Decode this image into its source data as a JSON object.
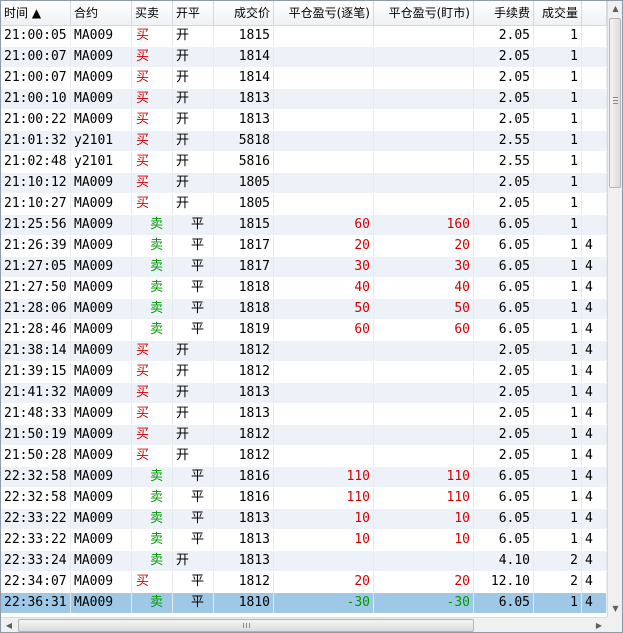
{
  "columns": {
    "time": "时间 ▲",
    "symbol": "合约",
    "bs": "买卖",
    "oc": "开平",
    "price": "成交价",
    "pnl_trade": "平仓盈亏(逐笔)",
    "pnl_mtm": "平仓盈亏(盯市)",
    "fee": "手续费",
    "qty": "成交量"
  },
  "rows": [
    {
      "time": "21:00:05",
      "symbol": "MA009",
      "bs": "买",
      "oc": "开",
      "price": "1815",
      "pnl_trade": "",
      "pnl_mtm": "",
      "fee": "2.05",
      "qty": "1",
      "ext": ""
    },
    {
      "time": "21:00:07",
      "symbol": "MA009",
      "bs": "买",
      "oc": "开",
      "price": "1814",
      "pnl_trade": "",
      "pnl_mtm": "",
      "fee": "2.05",
      "qty": "1",
      "ext": ""
    },
    {
      "time": "21:00:07",
      "symbol": "MA009",
      "bs": "买",
      "oc": "开",
      "price": "1814",
      "pnl_trade": "",
      "pnl_mtm": "",
      "fee": "2.05",
      "qty": "1",
      "ext": ""
    },
    {
      "time": "21:00:10",
      "symbol": "MA009",
      "bs": "买",
      "oc": "开",
      "price": "1813",
      "pnl_trade": "",
      "pnl_mtm": "",
      "fee": "2.05",
      "qty": "1",
      "ext": ""
    },
    {
      "time": "21:00:22",
      "symbol": "MA009",
      "bs": "买",
      "oc": "开",
      "price": "1813",
      "pnl_trade": "",
      "pnl_mtm": "",
      "fee": "2.05",
      "qty": "1",
      "ext": ""
    },
    {
      "time": "21:01:32",
      "symbol": "y2101",
      "bs": "买",
      "oc": "开",
      "price": "5818",
      "pnl_trade": "",
      "pnl_mtm": "",
      "fee": "2.55",
      "qty": "1",
      "ext": ""
    },
    {
      "time": "21:02:48",
      "symbol": "y2101",
      "bs": "买",
      "oc": "开",
      "price": "5816",
      "pnl_trade": "",
      "pnl_mtm": "",
      "fee": "2.55",
      "qty": "1",
      "ext": ""
    },
    {
      "time": "21:10:12",
      "symbol": "MA009",
      "bs": "买",
      "oc": "开",
      "price": "1805",
      "pnl_trade": "",
      "pnl_mtm": "",
      "fee": "2.05",
      "qty": "1",
      "ext": ""
    },
    {
      "time": "21:10:27",
      "symbol": "MA009",
      "bs": "买",
      "oc": "开",
      "price": "1805",
      "pnl_trade": "",
      "pnl_mtm": "",
      "fee": "2.05",
      "qty": "1",
      "ext": ""
    },
    {
      "time": "21:25:56",
      "symbol": "MA009",
      "bs": "卖",
      "oc": "平",
      "price": "1815",
      "pnl_trade": "60",
      "pnl_mtm": "160",
      "fee": "6.05",
      "qty": "1",
      "ext": ""
    },
    {
      "time": "21:26:39",
      "symbol": "MA009",
      "bs": "卖",
      "oc": "平",
      "price": "1817",
      "pnl_trade": "20",
      "pnl_mtm": "20",
      "fee": "6.05",
      "qty": "1",
      "ext": "4"
    },
    {
      "time": "21:27:05",
      "symbol": "MA009",
      "bs": "卖",
      "oc": "平",
      "price": "1817",
      "pnl_trade": "30",
      "pnl_mtm": "30",
      "fee": "6.05",
      "qty": "1",
      "ext": "4"
    },
    {
      "time": "21:27:50",
      "symbol": "MA009",
      "bs": "卖",
      "oc": "平",
      "price": "1818",
      "pnl_trade": "40",
      "pnl_mtm": "40",
      "fee": "6.05",
      "qty": "1",
      "ext": "4"
    },
    {
      "time": "21:28:06",
      "symbol": "MA009",
      "bs": "卖",
      "oc": "平",
      "price": "1818",
      "pnl_trade": "50",
      "pnl_mtm": "50",
      "fee": "6.05",
      "qty": "1",
      "ext": "4"
    },
    {
      "time": "21:28:46",
      "symbol": "MA009",
      "bs": "卖",
      "oc": "平",
      "price": "1819",
      "pnl_trade": "60",
      "pnl_mtm": "60",
      "fee": "6.05",
      "qty": "1",
      "ext": "4"
    },
    {
      "time": "21:38:14",
      "symbol": "MA009",
      "bs": "买",
      "oc": "开",
      "price": "1812",
      "pnl_trade": "",
      "pnl_mtm": "",
      "fee": "2.05",
      "qty": "1",
      "ext": "4"
    },
    {
      "time": "21:39:15",
      "symbol": "MA009",
      "bs": "买",
      "oc": "开",
      "price": "1812",
      "pnl_trade": "",
      "pnl_mtm": "",
      "fee": "2.05",
      "qty": "1",
      "ext": "4"
    },
    {
      "time": "21:41:32",
      "symbol": "MA009",
      "bs": "买",
      "oc": "开",
      "price": "1813",
      "pnl_trade": "",
      "pnl_mtm": "",
      "fee": "2.05",
      "qty": "1",
      "ext": "4"
    },
    {
      "time": "21:48:33",
      "symbol": "MA009",
      "bs": "买",
      "oc": "开",
      "price": "1813",
      "pnl_trade": "",
      "pnl_mtm": "",
      "fee": "2.05",
      "qty": "1",
      "ext": "4"
    },
    {
      "time": "21:50:19",
      "symbol": "MA009",
      "bs": "买",
      "oc": "开",
      "price": "1812",
      "pnl_trade": "",
      "pnl_mtm": "",
      "fee": "2.05",
      "qty": "1",
      "ext": "4"
    },
    {
      "time": "21:50:28",
      "symbol": "MA009",
      "bs": "买",
      "oc": "开",
      "price": "1812",
      "pnl_trade": "",
      "pnl_mtm": "",
      "fee": "2.05",
      "qty": "1",
      "ext": "4"
    },
    {
      "time": "22:32:58",
      "symbol": "MA009",
      "bs": "卖",
      "oc": "平",
      "price": "1816",
      "pnl_trade": "110",
      "pnl_mtm": "110",
      "fee": "6.05",
      "qty": "1",
      "ext": "4"
    },
    {
      "time": "22:32:58",
      "symbol": "MA009",
      "bs": "卖",
      "oc": "平",
      "price": "1816",
      "pnl_trade": "110",
      "pnl_mtm": "110",
      "fee": "6.05",
      "qty": "1",
      "ext": "4"
    },
    {
      "time": "22:33:22",
      "symbol": "MA009",
      "bs": "卖",
      "oc": "平",
      "price": "1813",
      "pnl_trade": "10",
      "pnl_mtm": "10",
      "fee": "6.05",
      "qty": "1",
      "ext": "4"
    },
    {
      "time": "22:33:22",
      "symbol": "MA009",
      "bs": "卖",
      "oc": "平",
      "price": "1813",
      "pnl_trade": "10",
      "pnl_mtm": "10",
      "fee": "6.05",
      "qty": "1",
      "ext": "4"
    },
    {
      "time": "22:33:24",
      "symbol": "MA009",
      "bs": "卖",
      "oc": "开",
      "price": "1813",
      "pnl_trade": "",
      "pnl_mtm": "",
      "fee": "4.10",
      "qty": "2",
      "ext": "4"
    },
    {
      "time": "22:34:07",
      "symbol": "MA009",
      "bs": "买",
      "oc": "平",
      "price": "1812",
      "pnl_trade": "20",
      "pnl_mtm": "20",
      "fee": "12.10",
      "qty": "2",
      "ext": "4"
    },
    {
      "time": "22:36:31",
      "symbol": "MA009",
      "bs": "卖",
      "oc": "平",
      "price": "1810",
      "pnl_trade": "-30",
      "pnl_mtm": "-30",
      "fee": "6.05",
      "qty": "1",
      "ext": "4",
      "selected": true
    }
  ],
  "scrollbars": {
    "up": "▲",
    "down": "▼",
    "left": "◀",
    "right": "▶"
  },
  "colors": {
    "buy": "#d40000",
    "sell": "#009a00",
    "selected_row": "#9fc8e6",
    "alt_row": "#edf1f8"
  }
}
